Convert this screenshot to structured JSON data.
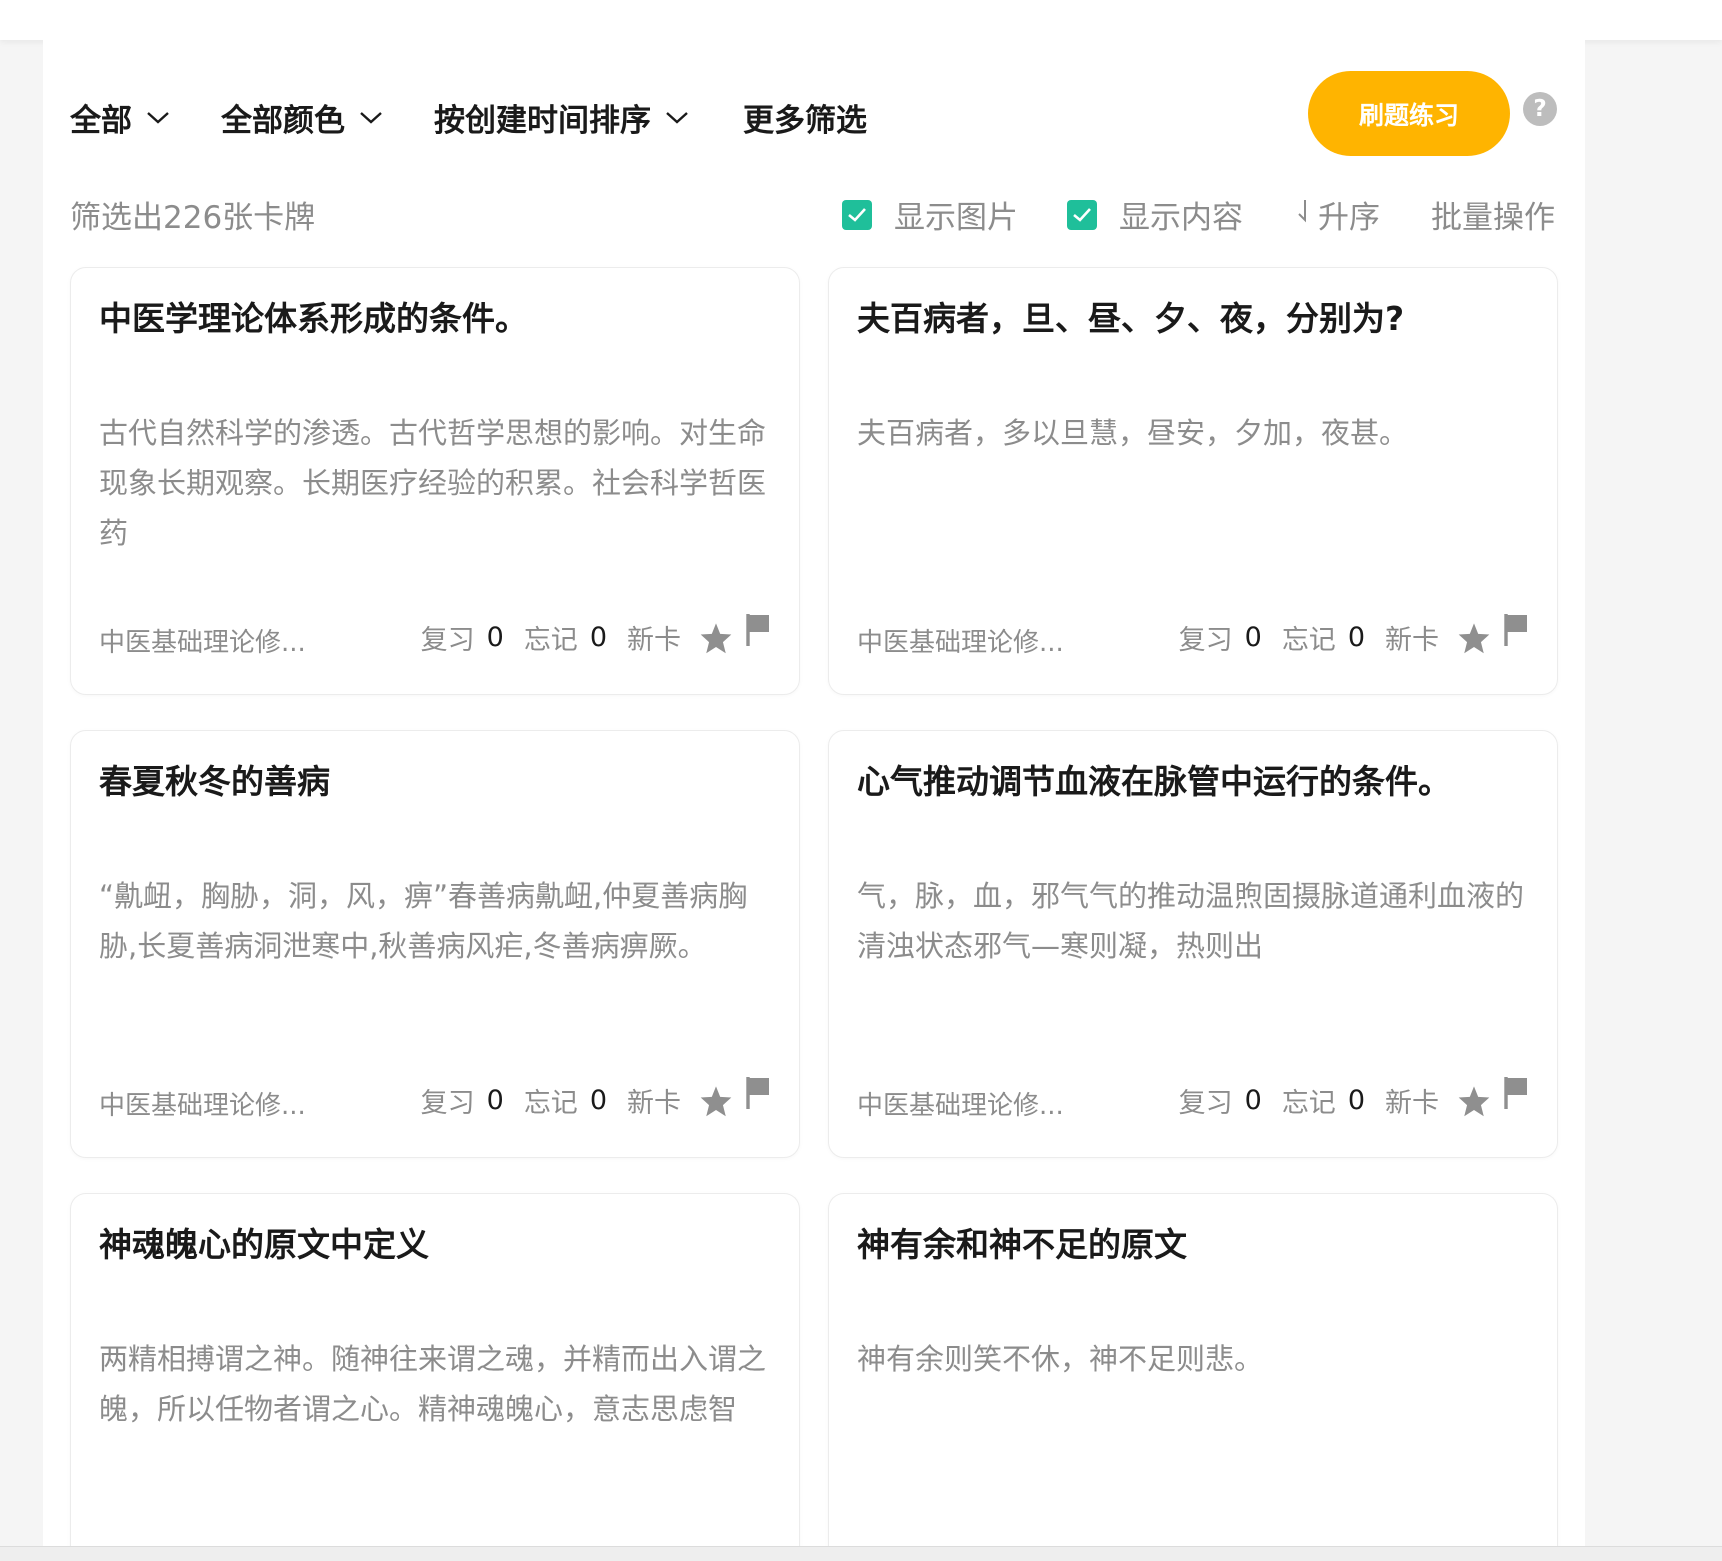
{
  "filters": {
    "scope": "全部",
    "color": "全部颜色",
    "sort": "按创建时间排序",
    "more": "更多筛选"
  },
  "practice_button": "刷题练习",
  "help": "?",
  "count_text": "筛选出226张卡牌",
  "options": {
    "show_images": "显示图片",
    "show_content": "显示内容",
    "ascending": "升序",
    "batch": "批量操作"
  },
  "colors": {
    "accent": "#ffb400",
    "check": "#1fbf9a",
    "muted": "#8c8c8c",
    "icon": "#8f8f8f"
  },
  "cards": [
    {
      "title": "中医学理论体系形成的条件。",
      "body": "古代自然科学的渗透。古代哲学思想的影响。对生命现象长期观察。长期医疗经验的积累。社会科学哲医药",
      "deck": "中医基础理论修...",
      "review_label": "复习",
      "review": "0",
      "forget_label": "忘记",
      "forget": "0",
      "status": "新卡"
    },
    {
      "title": "夫百病者，旦、昼、夕、夜，分别为?",
      "body": "夫百病者，多以旦慧，昼安，夕加，夜甚。",
      "deck": "中医基础理论修...",
      "review_label": "复习",
      "review": "0",
      "forget_label": "忘记",
      "forget": "0",
      "status": "新卡"
    },
    {
      "title": "春夏秋冬的善病",
      "body": "“鼽衄，胸胁，洞，风，痹”春善病鼽衄,仲夏善病胸胁,长夏善病洞泄寒中,秋善病风疟,冬善病痹厥。",
      "deck": "中医基础理论修...",
      "review_label": "复习",
      "review": "0",
      "forget_label": "忘记",
      "forget": "0",
      "status": "新卡"
    },
    {
      "title": "心气推动调节血液在脉管中运行的条件。",
      "body": "气，脉，血，邪气气的推动温煦固摄脉道通利血液的清浊状态邪气—寒则凝，热则出",
      "deck": "中医基础理论修...",
      "review_label": "复习",
      "review": "0",
      "forget_label": "忘记",
      "forget": "0",
      "status": "新卡"
    },
    {
      "title": "神魂魄心的原文中定义",
      "body": "两精相搏谓之神。随神往来谓之魂，并精而出入谓之魄，所以任物者谓之心。精神魂魄心，意志思虑智"
    },
    {
      "title": "神有余和神不足的原文",
      "body": "神有余则笑不休，神不足则悲。"
    }
  ]
}
